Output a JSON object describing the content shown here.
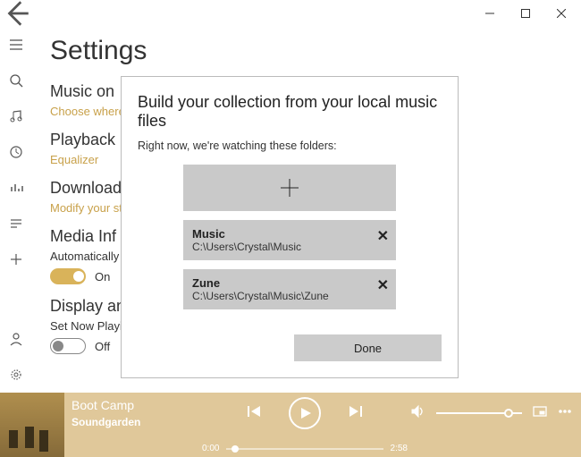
{
  "page_title": "Settings",
  "sections": {
    "music_on": {
      "heading": "Music on",
      "sub": "Choose where"
    },
    "playback": {
      "heading": "Playback",
      "sub": "Equalizer"
    },
    "downloads": {
      "heading": "Download",
      "sub": "Modify your st"
    },
    "media_info": {
      "heading": "Media Inf",
      "sub": "Automatically",
      "toggle_label": "On"
    },
    "display": {
      "heading": "Display an",
      "sub": "Set Now Playin",
      "toggle_label": "Off"
    }
  },
  "dialog": {
    "title": "Build your collection from your local music files",
    "subtitle": "Right now, we're watching these folders:",
    "folders": [
      {
        "name": "Music",
        "path": "C:\\Users\\Crystal\\Music"
      },
      {
        "name": "Zune",
        "path": "C:\\Users\\Crystal\\Music\\Zune"
      }
    ],
    "done_label": "Done"
  },
  "player": {
    "track_title": "Boot Camp",
    "artist": "Soundgarden",
    "elapsed": "0:00",
    "duration": "2:58"
  }
}
